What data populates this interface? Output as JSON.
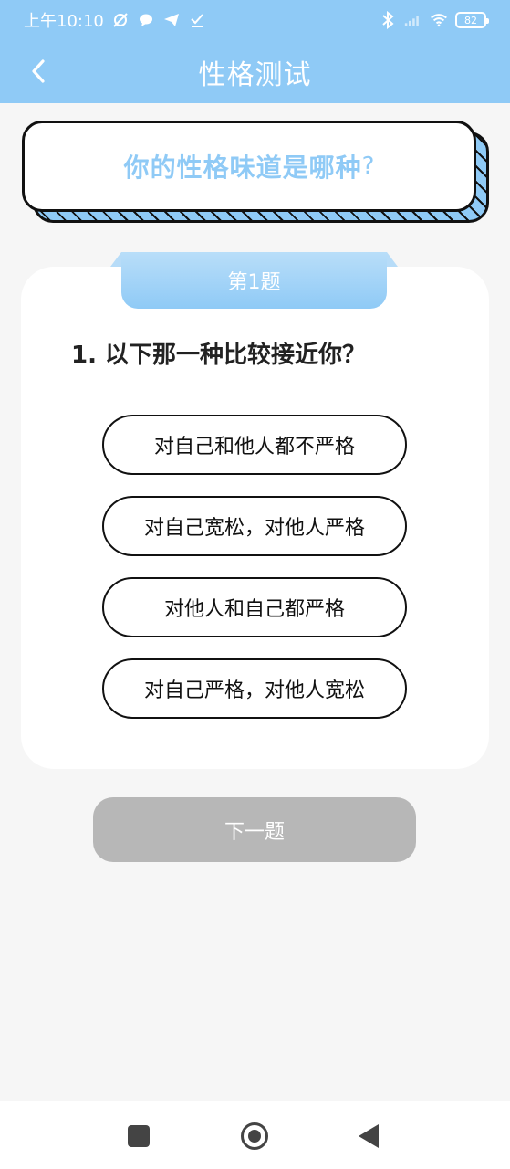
{
  "status_bar": {
    "time": "上午10:10",
    "battery": "82"
  },
  "nav": {
    "title": "性格测试"
  },
  "banner": {
    "title": "你的性格味道是哪种",
    "question_mark": "?"
  },
  "question": {
    "tab_label": "第1题",
    "text": "1. 以下那一种比较接近你？",
    "options": [
      "对自己和他人都不严格",
      "对自己宽松，对他人严格",
      "对他人和自己都严格",
      "对自己严格，对他人宽松"
    ]
  },
  "actions": {
    "next_label": "下一题"
  },
  "colors": {
    "accent": "#8fcaf6",
    "next_disabled": "#b7b7b7"
  }
}
